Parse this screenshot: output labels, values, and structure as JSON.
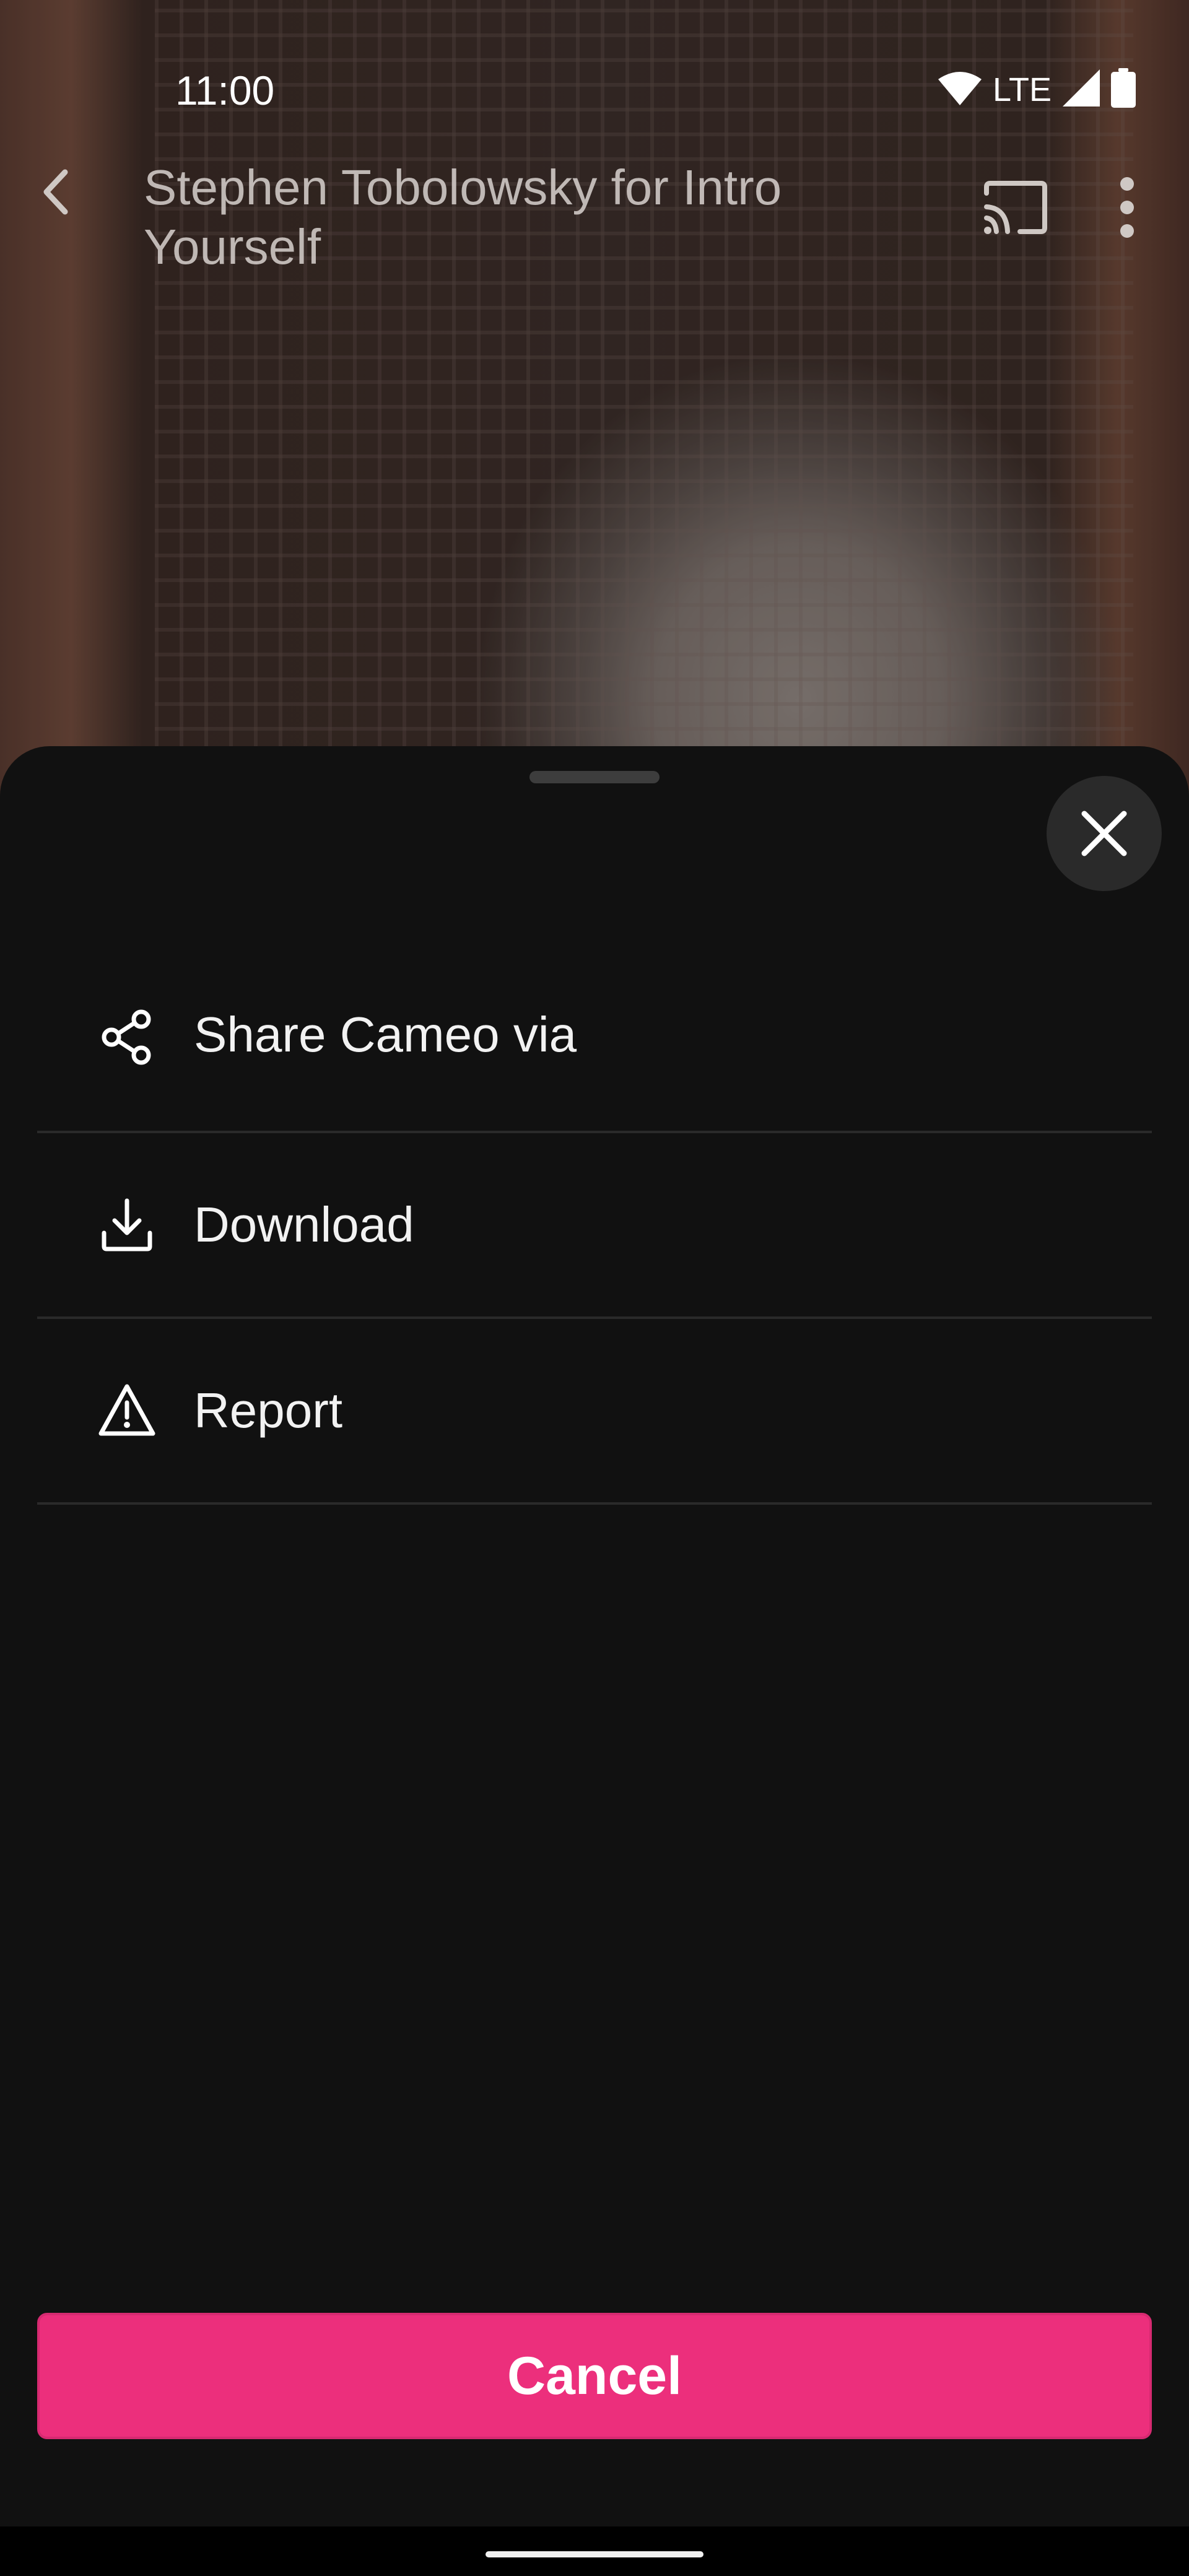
{
  "status_bar": {
    "time": "11:00",
    "network": "LTE",
    "icons": [
      "wifi-icon",
      "cell-signal-icon",
      "battery-icon"
    ]
  },
  "toolbar": {
    "title": "Stephen Tobolowsky for Intro Yourself",
    "icons": [
      "back-arrow-icon",
      "cast-icon",
      "more-vert-icon"
    ]
  },
  "sheet": {
    "items": [
      {
        "label": "Share Cameo via",
        "icon": "share-icon"
      },
      {
        "label": "Download",
        "icon": "download-icon"
      },
      {
        "label": "Report",
        "icon": "warning-icon"
      }
    ],
    "cancel_label": "Cancel",
    "close_icon": "close-icon"
  },
  "colors": {
    "sheet_background": "#111111",
    "accent": "#ec2f7c",
    "divider": "#2a2a2a"
  }
}
